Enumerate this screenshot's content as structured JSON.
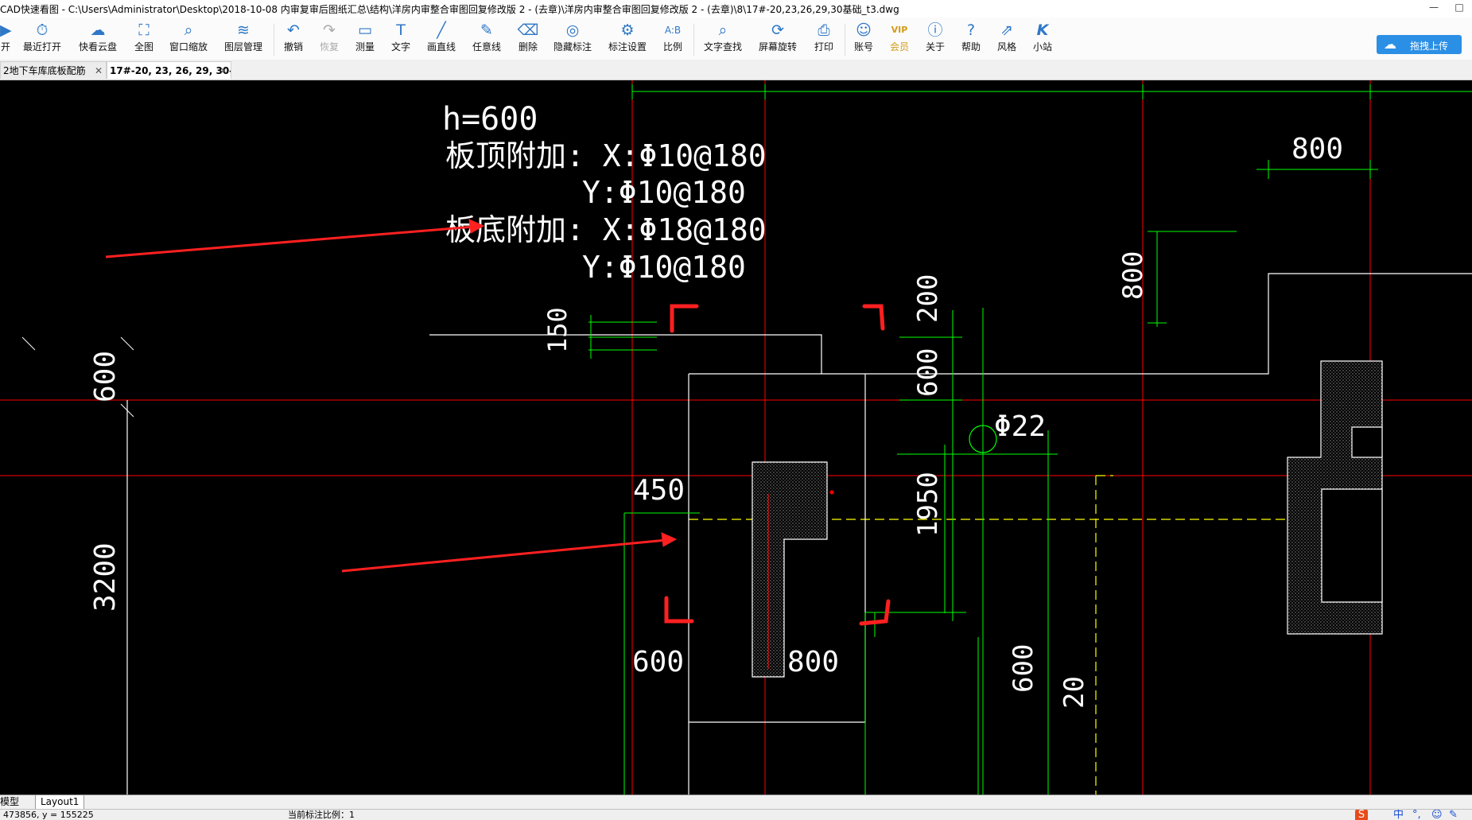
{
  "window": {
    "title": "CAD快速看图 - C:\\Users\\Administrator\\Desktop\\2018-10-08 内审复审后图纸汇总\\结构\\洋房内审整合审图回复修改版 2 - (去章)\\洋房内审整合审图回复修改版 2 - (去章)\\8\\17#-20,23,26,29,30基础_t3.dwg",
    "minimize": "—",
    "maximize": "□",
    "close": "✕"
  },
  "toolbar": {
    "items": [
      {
        "label": "开",
        "icon": "open-icon",
        "glyph": "▶"
      },
      {
        "label": "最近打开",
        "icon": "recent-icon",
        "glyph": "⏱"
      },
      {
        "label": "快看云盘",
        "icon": "cloud-icon",
        "glyph": "☁"
      },
      {
        "label": "全图",
        "icon": "fullview-icon",
        "glyph": "⛶"
      },
      {
        "label": "窗口缩放",
        "icon": "window-zoom-icon",
        "glyph": "⌕"
      },
      {
        "label": "图层管理",
        "icon": "layers-icon",
        "glyph": "≋"
      },
      {
        "label": "撤销",
        "icon": "undo-icon",
        "glyph": "↶"
      },
      {
        "label": "恢复",
        "icon": "redo-icon",
        "glyph": "↷"
      },
      {
        "label": "测量",
        "icon": "measure-icon",
        "glyph": "▭"
      },
      {
        "label": "文字",
        "icon": "text-icon",
        "glyph": "T"
      },
      {
        "label": "画直线",
        "icon": "line-icon",
        "glyph": "╱"
      },
      {
        "label": "任意线",
        "icon": "freehand-icon",
        "glyph": "✎"
      },
      {
        "label": "删除",
        "icon": "eraser-icon",
        "glyph": "⌫"
      },
      {
        "label": "隐藏标注",
        "icon": "hide-annotation-icon",
        "glyph": "◎"
      },
      {
        "label": "标注设置",
        "icon": "annotation-settings-icon",
        "glyph": "⚙"
      },
      {
        "label": "比例",
        "icon": "scale-icon",
        "glyph": "A:B"
      },
      {
        "label": "文字查找",
        "icon": "text-search-icon",
        "glyph": "⌕"
      },
      {
        "label": "屏幕旋转",
        "icon": "rotate-screen-icon",
        "glyph": "⟳"
      },
      {
        "label": "打印",
        "icon": "print-icon",
        "glyph": "⎙"
      },
      {
        "label": "账号",
        "icon": "account-icon",
        "glyph": "☺"
      },
      {
        "label": "会员",
        "icon": "vip-icon",
        "glyph": "VIP"
      },
      {
        "label": "关于",
        "icon": "about-icon",
        "glyph": "ⓘ"
      },
      {
        "label": "帮助",
        "icon": "help-icon",
        "glyph": "?"
      },
      {
        "label": "风格",
        "icon": "style-icon",
        "glyph": "⇗"
      },
      {
        "label": "小站",
        "icon": "site-icon",
        "glyph": "K"
      }
    ],
    "upload_label": "拖拽上传"
  },
  "tabs": [
    {
      "label": "2地下车库底板配筋",
      "close": "✕"
    },
    {
      "label": "17#-20, 23, 26, 29, 30--",
      "close": "✕"
    }
  ],
  "drawing": {
    "note_h": "h=600",
    "note_top_x": "板顶附加: X:Φ10@180",
    "note_top_y": "Y:Φ10@180",
    "note_bottom_x": "板底附加: X:Φ18@180",
    "note_bottom_y": "Y:Φ10@180",
    "rebar_label": "Φ22",
    "dims": {
      "d800_top": "800",
      "d800_vertical": "800",
      "d150": "150",
      "d200": "200",
      "d600_right": "600",
      "d1950": "1950",
      "d450": "450",
      "d600_left": "600",
      "d3200": "3200",
      "d600_bottom": "600",
      "d800_bottom": "800",
      "d600_bottom_v": "600",
      "d20_partial": "20"
    },
    "colors": {
      "background": "#000000",
      "axis_red": "#ff0000",
      "dim_green": "#00ff00",
      "outline_white": "#ffffff",
      "hidden_yellow": "#ffff00",
      "markup_red": "#ff2020"
    }
  },
  "layout_tabs": [
    "模型",
    "Layout1"
  ],
  "status": {
    "coords": "473856, y = 155225",
    "scale": "当前标注比例：1"
  },
  "tray": {
    "ime_logo": "S",
    "ime_lang": "中",
    "ime_punct": "°,",
    "ime_emoji": "☺",
    "ime_tool": "✎"
  }
}
